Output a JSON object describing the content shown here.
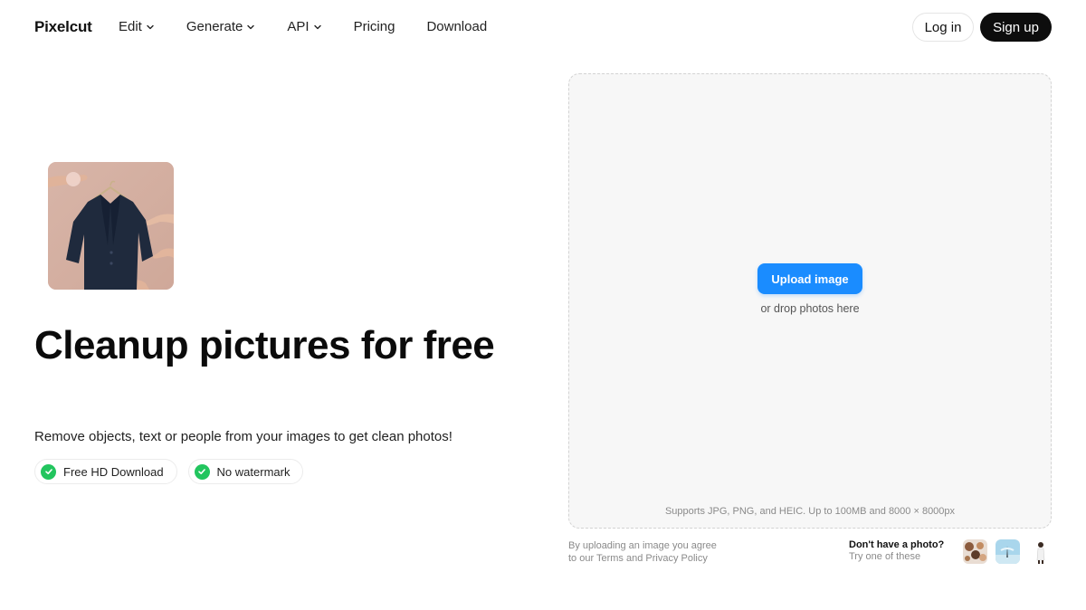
{
  "nav": {
    "logo": "Pixelcut",
    "links": [
      {
        "label": "Edit",
        "dropdown": true
      },
      {
        "label": "Generate",
        "dropdown": true
      },
      {
        "label": "API",
        "dropdown": true
      },
      {
        "label": "Pricing",
        "dropdown": false
      },
      {
        "label": "Download",
        "dropdown": false
      }
    ],
    "login": "Log in",
    "signup": "Sign up"
  },
  "hero": {
    "title": "Cleanup pictures for free",
    "subtitle": "Remove objects, text or people from your images to get clean photos!",
    "badges": [
      "Free HD Download",
      "No watermark"
    ]
  },
  "upload": {
    "button": "Upload image",
    "hint": "or drop photos here",
    "supports": "Supports JPG, PNG, and HEIC. Up to 100MB and 8000 × 8000px",
    "legal_line1": "By uploading an image you agree",
    "legal_line2": "to our Terms and Privacy Policy",
    "no_photo": "Don't have a photo?",
    "try_these": "Try one of these"
  },
  "colors": {
    "accent": "#1a8cff",
    "check": "#22c55e",
    "signup_bg": "#0d0d0d"
  }
}
